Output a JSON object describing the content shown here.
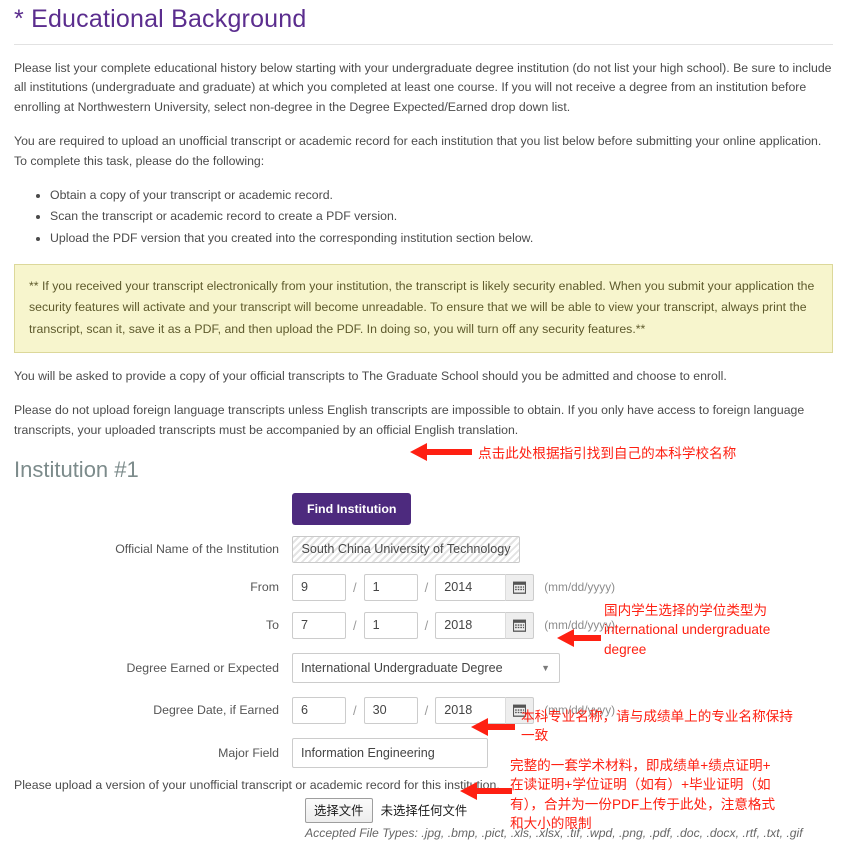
{
  "header": {
    "title": "* Educational Background"
  },
  "intro": {
    "paragraph1": "Please list your complete educational history below starting with your undergraduate degree institution (do not list your high school). Be sure to include all institutions (undergraduate and graduate) at which you completed at least one course. If you will not receive a degree from an institution before enrolling at Northwestern University, select non-degree in the Degree Expected/Earned drop down list.",
    "paragraph2": "You are required to upload an unofficial transcript or academic record for each institution that you list below before submitting your online application. To complete this task, please do the following:",
    "steps": [
      "Obtain a copy of your transcript or academic record.",
      "Scan the transcript or academic record to create a PDF version.",
      "Upload the PDF version that you created into the corresponding institution section below."
    ],
    "callout": "** If you received your transcript electronically from your institution, the transcript is likely security enabled. When you submit your application the security features will activate and your transcript will become unreadable. To ensure that we will be able to view your transcript, always print the transcript, scan it, save it as a PDF, and then upload the PDF. In doing so, you will turn off any security features.**",
    "paragraph3": "You will be asked to provide a copy of your official transcripts to The Graduate School should you be admitted and choose to enroll.",
    "paragraph4": "Please do not upload foreign language transcripts unless English transcripts are impossible to obtain. If you only have access to foreign language transcripts, your uploaded transcripts must be accompanied by an official English translation."
  },
  "institution": {
    "section_title": "Institution #1",
    "find_button_label": "Find Institution",
    "official_name_label": "Official Name of the Institution",
    "official_name_value": "South China University of Technology",
    "from_label": "From",
    "from_month": "9",
    "from_day": "1",
    "from_year": "2014",
    "to_label": "To",
    "to_month": "7",
    "to_day": "1",
    "to_year": "2018",
    "date_format_hint": "(mm/dd/yyyy)",
    "date_separator": "/",
    "degree_label": "Degree Earned or Expected",
    "degree_value": "International Undergraduate Degree",
    "degree_date_label": "Degree Date, if Earned",
    "degree_month": "6",
    "degree_day": "30",
    "degree_year": "2018",
    "major_label": "Major Field",
    "major_value": "Information Engineering",
    "upload_note": "Please upload a version of your unofficial transcript or academic record for this institution.",
    "file_button_label": "选择文件",
    "file_status": "未选择任何文件",
    "accepted_types": "Accepted File Types: .jpg, .bmp, .pict, .xls, .xlsx, .tif, .wpd, .png, .pdf, .doc, .docx, .rtf, .txt, .gif"
  },
  "annotations": {
    "find_institution": "点击此处根据指引找到自己的本科学校名称",
    "degree_type": "国内学生选择的学位类型为\ninternational undergraduate\ndegree",
    "major_field": "本科专业名称，请与成绩单上的专业名称保持\n一致",
    "upload": "完整的一套学术材料，即成绩单+绩点证明+\n在读证明+学位证明（如有）+毕业证明（如\n有），合并为一份PDF上传于此处，注意格式\n和大小的限制"
  },
  "colors": {
    "brand_purple": "#4d2a7e",
    "annotation_red": "#fe2012",
    "callout_bg": "#f7f5cd",
    "section_gray": "#7c8b8b"
  }
}
